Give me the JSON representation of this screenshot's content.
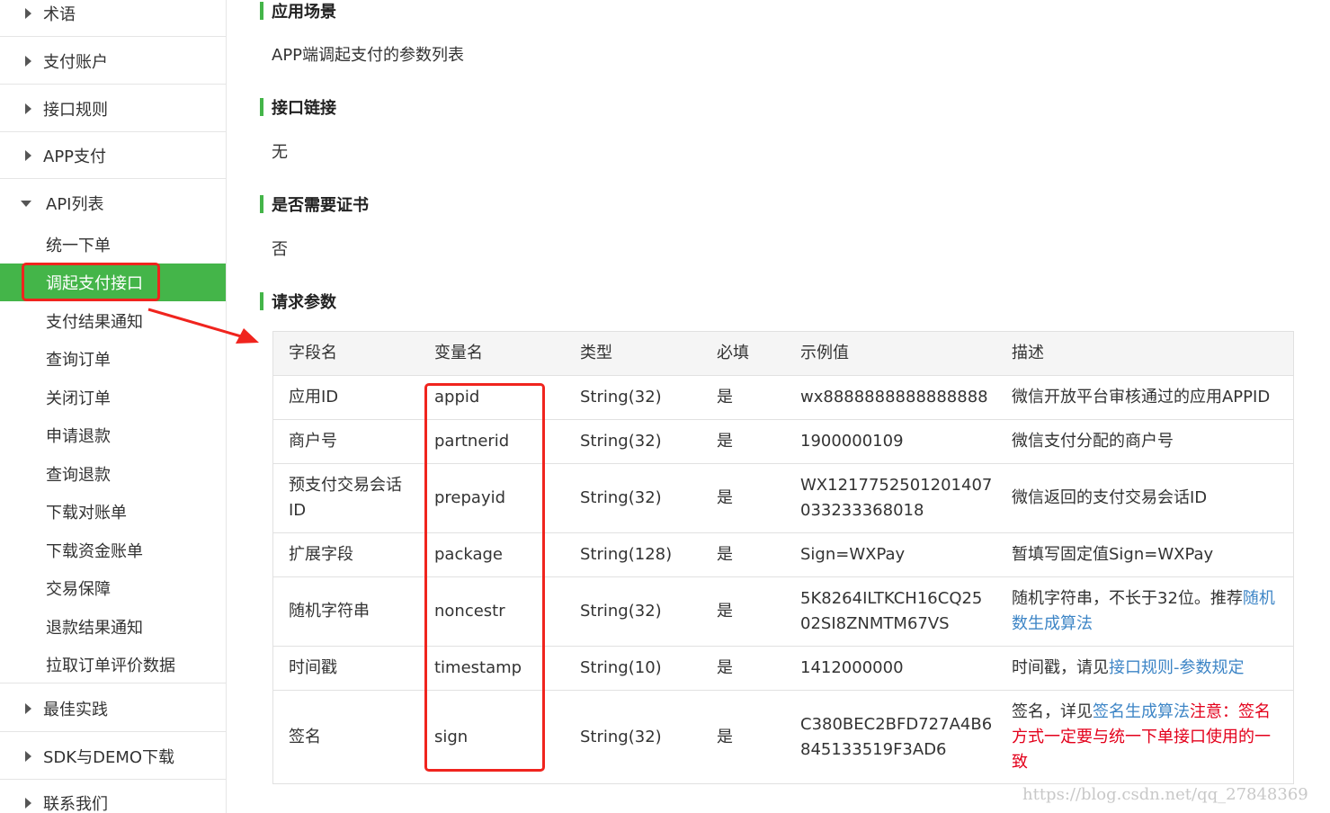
{
  "sidebar": {
    "groups_top": [
      {
        "label": "术语"
      },
      {
        "label": "支付账户"
      },
      {
        "label": "接口规则"
      },
      {
        "label": "APP支付"
      }
    ],
    "api_group": {
      "label": "API列表"
    },
    "api_items": [
      {
        "label": "统一下单"
      },
      {
        "label": "调起支付接口"
      },
      {
        "label": "支付结果通知"
      },
      {
        "label": "查询订单"
      },
      {
        "label": "关闭订单"
      },
      {
        "label": "申请退款"
      },
      {
        "label": "查询退款"
      },
      {
        "label": "下载对账单"
      },
      {
        "label": "下载资金账单"
      },
      {
        "label": "交易保障"
      },
      {
        "label": "退款结果通知"
      },
      {
        "label": "拉取订单评价数据"
      }
    ],
    "active_item": "调起支付接口",
    "groups_bottom": [
      {
        "label": "最佳实践"
      },
      {
        "label": "SDK与DEMO下载"
      },
      {
        "label": "联系我们"
      }
    ]
  },
  "main": {
    "sections": [
      {
        "title": "应用场景",
        "body": "APP端调起支付的参数列表"
      },
      {
        "title": "接口链接",
        "body": "无"
      },
      {
        "title": "是否需要证书",
        "body": "否"
      },
      {
        "title": "请求参数",
        "body": ""
      }
    ],
    "table": {
      "headers": [
        "字段名",
        "变量名",
        "类型",
        "必填",
        "示例值",
        "描述"
      ],
      "rows": [
        {
          "name": "应用ID",
          "var": "appid",
          "type": "String(32)",
          "required": "是",
          "example": "wx8888888888888888",
          "desc": "微信开放平台审核通过的应用APPID"
        },
        {
          "name": "商户号",
          "var": "partnerid",
          "type": "String(32)",
          "required": "是",
          "example": "1900000109",
          "desc": "微信支付分配的商户号"
        },
        {
          "name": "预支付交易会话ID",
          "name_lines": [
            "预支付交易会话",
            "ID"
          ],
          "var": "prepayid",
          "type": "String(32)",
          "required": "是",
          "example": "WX1217752501201407033233368018",
          "example_lines": [
            "WX1217752501201407",
            "033233368018"
          ],
          "desc": "微信返回的支付交易会话ID"
        },
        {
          "name": "扩展字段",
          "var": "package",
          "type": "String(128)",
          "required": "是",
          "example": "Sign=WXPay",
          "desc": "暂填写固定值Sign=WXPay"
        },
        {
          "name": "随机字符串",
          "var": "noncestr",
          "type": "String(32)",
          "required": "是",
          "example": "5K8264ILTKCH16CQ2502SI8ZNMTM67VS",
          "example_lines": [
            "5K8264ILTKCH16CQ25",
            "02SI8ZNMTM67VS"
          ],
          "desc_text": "随机字符串，不长于32位。推荐",
          "desc_link": "随机数生成算法",
          "desc_link_lines": [
            "随机",
            "数生成算法"
          ]
        },
        {
          "name": "时间戳",
          "var": "timestamp",
          "type": "String(10)",
          "required": "是",
          "example": "1412000000",
          "desc_text": "时间戳，请见",
          "desc_link": "接口规则-参数规定"
        },
        {
          "name": "签名",
          "var": "sign",
          "type": "String(32)",
          "required": "是",
          "example": "C380BEC2BFD727A4B6845133519F3AD6",
          "example_lines": [
            "C380BEC2BFD727A4B6",
            "845133519F3AD6"
          ],
          "desc_text": "签名，详见",
          "desc_link": "签名生成算法",
          "desc_warn": "注意：签名方式一定要与统一下单接口使用的一致",
          "desc_warn_lines": [
            "注意：签名",
            "方式一定要与统一下单接口使用的一",
            "致"
          ]
        }
      ]
    }
  },
  "watermark": "https://blog.csdn.net/qq_27848369",
  "colors": {
    "accent": "#44b549",
    "highlight": "#f0241e",
    "link": "#3d85c6",
    "warning": "#e3001b"
  },
  "icons": {
    "collapsed": "triangle-right-icon",
    "expanded": "triangle-down-icon",
    "annotation": "arrow-icon"
  }
}
